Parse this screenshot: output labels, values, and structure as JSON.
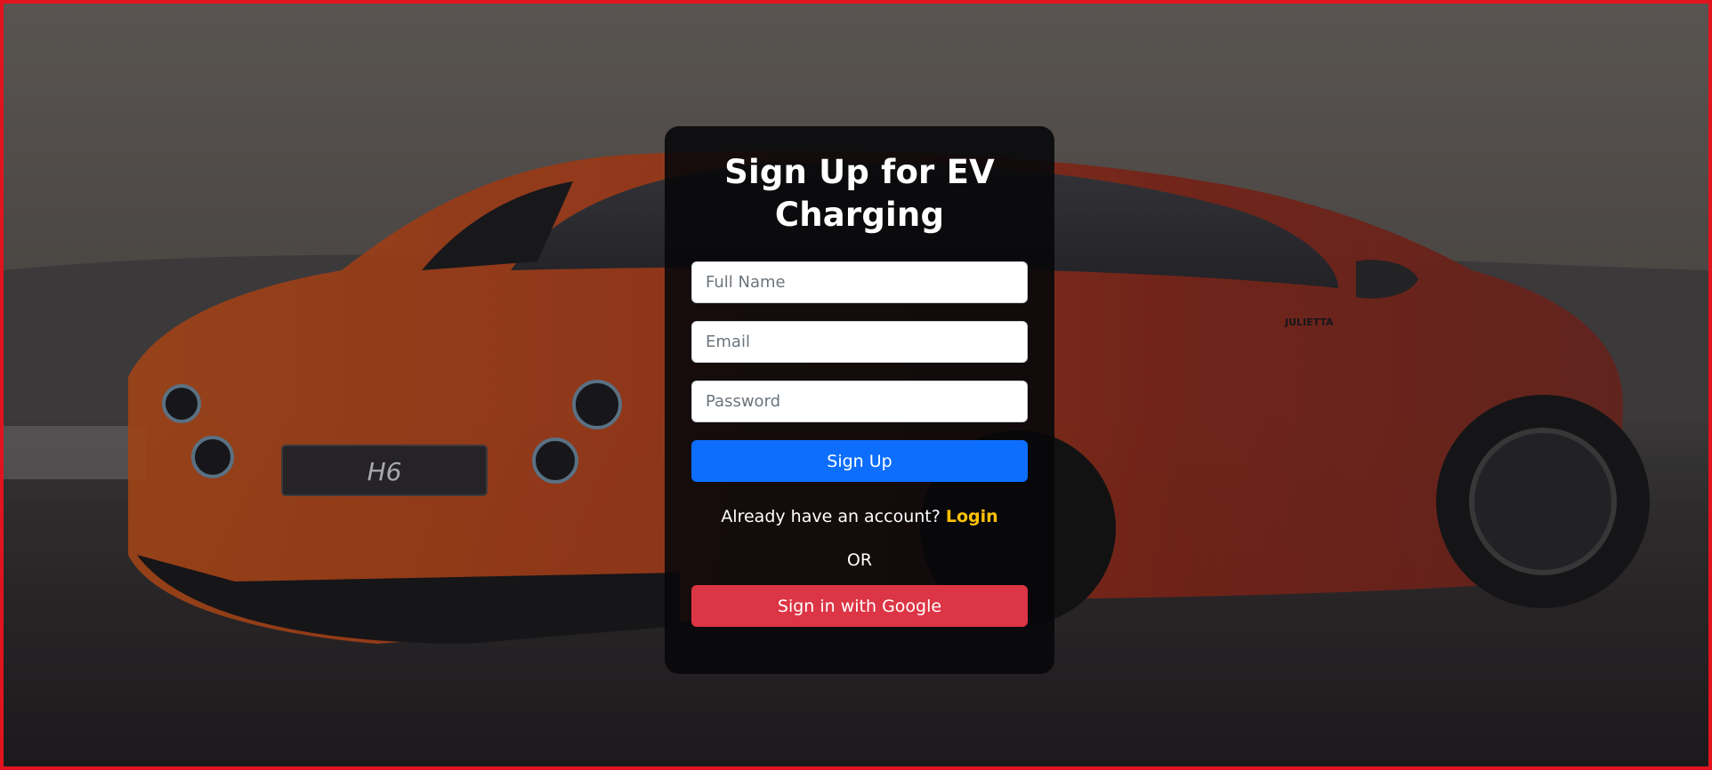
{
  "colors": {
    "frame_border": "#e0141e",
    "primary": "#0d6efd",
    "google": "#dc3545",
    "login_link": "#ffc107"
  },
  "background": {
    "description_icon": "car-photo",
    "plate_text": "H6",
    "badge_text": "JULIETTA"
  },
  "signup": {
    "title": "Sign Up for EV Charging",
    "full_name_placeholder": "Full Name",
    "email_placeholder": "Email",
    "password_placeholder": "Password",
    "submit_label": "Sign Up",
    "account_prompt": "Already have an account?",
    "login_label": "Login",
    "divider_text": "OR",
    "google_label": "Sign in with Google"
  }
}
